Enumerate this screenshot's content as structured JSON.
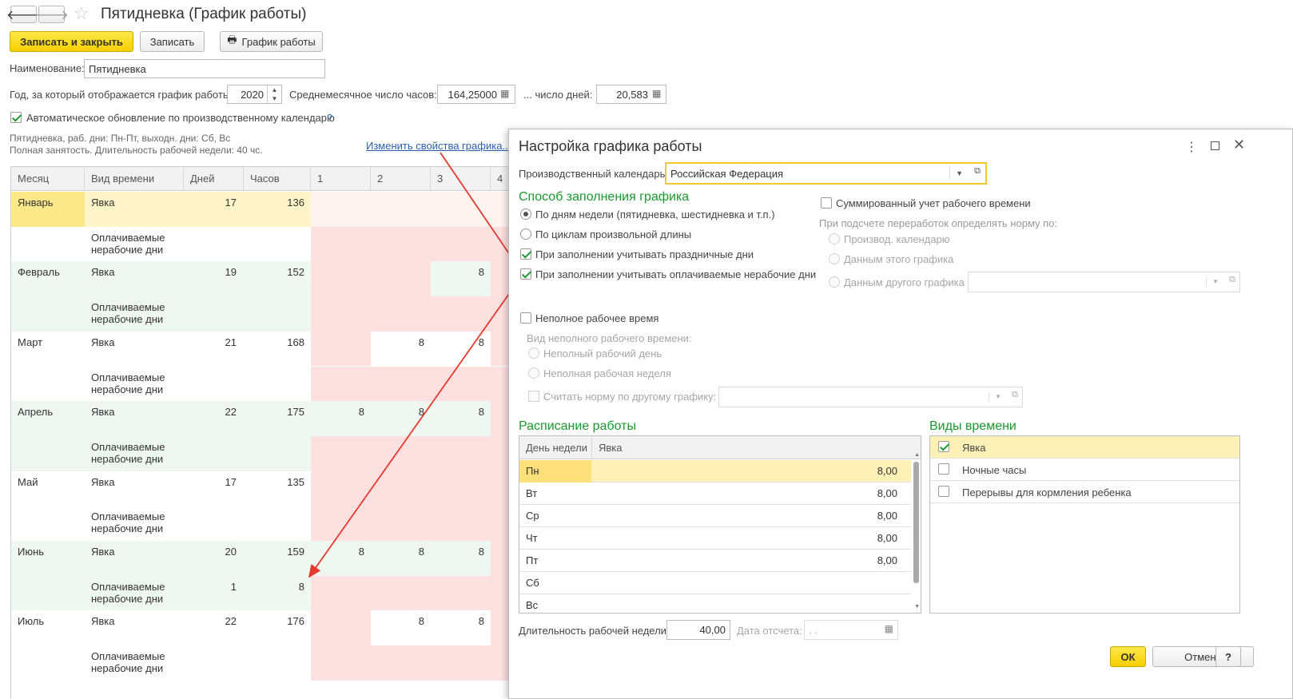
{
  "window": {
    "title": "Пятидневка (График работы)"
  },
  "toolbar": {
    "save_close": "Записать и закрыть",
    "save": "Записать",
    "schedule": "График работы"
  },
  "form": {
    "name_label": "Наименование:",
    "name_value": "Пятидневка",
    "year_label": "Год, за который отображается график работы:",
    "year_value": "2020",
    "avg_hours_label": "Среднемесячное число часов:",
    "avg_hours_value": "164,25000",
    "days_label": "... число дней:",
    "days_value": "20,583",
    "auto_update_label": "Автоматическое обновление по производственному календарю",
    "help_mark": "?",
    "desc_line1": "Пятидневка, раб. дни: Пн-Пт, выходн. дни: Сб, Вс",
    "desc_line2": "Полная занятость. Длительность рабочей недели: 40 чс.",
    "change_link": "Изменить свойства графика..."
  },
  "grid": {
    "headers": [
      "Месяц",
      "Вид времени",
      "Дней",
      "Часов",
      "1",
      "2",
      "3",
      "4"
    ],
    "rows": [
      {
        "month": "Январь",
        "kind": "Явка",
        "days": "17",
        "hours": "136",
        "d1": "",
        "d2": "",
        "d3": "",
        "d4": ""
      },
      {
        "month": "",
        "kind": "Оплачиваемые нерабочие дни",
        "days": "",
        "hours": "",
        "d1": "",
        "d2": "",
        "d3": "",
        "d4": ""
      },
      {
        "month": "Февраль",
        "kind": "Явка",
        "days": "19",
        "hours": "152",
        "d1": "",
        "d2": "",
        "d3": "8",
        "d4": ""
      },
      {
        "month": "",
        "kind": "Оплачиваемые нерабочие дни",
        "days": "",
        "hours": "",
        "d1": "",
        "d2": "",
        "d3": "",
        "d4": ""
      },
      {
        "month": "Март",
        "kind": "Явка",
        "days": "21",
        "hours": "168",
        "d1": "",
        "d2": "8",
        "d3": "8",
        "d4": ""
      },
      {
        "month": "",
        "kind": "Оплачиваемые нерабочие дни",
        "days": "",
        "hours": "",
        "d1": "",
        "d2": "",
        "d3": "",
        "d4": ""
      },
      {
        "month": "Апрель",
        "kind": "Явка",
        "days": "22",
        "hours": "175",
        "d1": "8",
        "d2": "8",
        "d3": "8",
        "d4": ""
      },
      {
        "month": "",
        "kind": "Оплачиваемые нерабочие дни",
        "days": "",
        "hours": "",
        "d1": "",
        "d2": "",
        "d3": "",
        "d4": ""
      },
      {
        "month": "Май",
        "kind": "Явка",
        "days": "17",
        "hours": "135",
        "d1": "",
        "d2": "",
        "d3": "",
        "d4": ""
      },
      {
        "month": "",
        "kind": "Оплачиваемые нерабочие дни",
        "days": "",
        "hours": "",
        "d1": "",
        "d2": "",
        "d3": "",
        "d4": ""
      },
      {
        "month": "Июнь",
        "kind": "Явка",
        "days": "20",
        "hours": "159",
        "d1": "8",
        "d2": "8",
        "d3": "8",
        "d4": ""
      },
      {
        "month": "",
        "kind": "Оплачиваемые нерабочие дни",
        "days": "1",
        "hours": "8",
        "d1": "",
        "d2": "",
        "d3": "",
        "d4": ""
      },
      {
        "month": "Июль",
        "kind": "Явка",
        "days": "22",
        "hours": "176",
        "d1": "",
        "d2": "8",
        "d3": "8",
        "d4": ""
      },
      {
        "month": "",
        "kind": "Оплачиваемые нерабочие дни",
        "days": "",
        "hours": "",
        "d1": "",
        "d2": "",
        "d3": "",
        "d4": ""
      }
    ]
  },
  "dialog": {
    "title": "Настройка графика работы",
    "calendar_label": "Производственный календарь:",
    "calendar_value": "Российская Федерация",
    "fill_method_title": "Способ заполнения графика",
    "opt_weekdays": "По дням недели (пятидневка, шестидневка и т.п.)",
    "opt_cycles": "По циклам произвольной длины",
    "opt_holidays": "При заполнении учитывать праздничные дни",
    "opt_paid_nonwork": "При заполнении учитывать оплачиваемые нерабочие дни",
    "summary_label": "Суммированный учет рабочего времени",
    "overtime_label": "При подсчете переработок определять норму по:",
    "ot_calendar": "Производ. календарю",
    "ot_this": "Данным этого графика",
    "ot_other": "Данным другого графика",
    "part_time": "Неполное рабочее время",
    "part_kind_label": "Вид неполного рабочего времени:",
    "part_day": "Неполный рабочий день",
    "part_week": "Неполная рабочая неделя",
    "other_norm": "Считать норму по другому графику:",
    "schedule_title": "Расписание работы",
    "sched_headers": [
      "День недели",
      "Явка"
    ],
    "sched_rows": [
      {
        "day": "Пн",
        "value": "8,00"
      },
      {
        "day": "Вт",
        "value": "8,00"
      },
      {
        "day": "Ср",
        "value": "8,00"
      },
      {
        "day": "Чт",
        "value": "8,00"
      },
      {
        "day": "Пт",
        "value": "8,00"
      },
      {
        "day": "Сб",
        "value": ""
      },
      {
        "day": "Вс",
        "value": ""
      }
    ],
    "time_kinds_title": "Виды времени",
    "time_kinds": [
      {
        "label": "Явка",
        "checked": true
      },
      {
        "label": "Ночные часы",
        "checked": false
      },
      {
        "label": "Перерывы для кормления ребенка",
        "checked": false
      }
    ],
    "week_len_label": "Длительность рабочей недели:",
    "week_len_value": "40,00",
    "ref_date_label": "Дата отсчета:",
    "ref_date_value": " .  .",
    "ok": "ОК",
    "cancel": "Отмена",
    "help": "?"
  },
  "colors": {
    "accent_green": "#1a9a2c",
    "yellow": "#f6cf00",
    "pink": "#fde0e0",
    "light_green": "#eef8f0",
    "row_select": "#fdf1b8"
  }
}
